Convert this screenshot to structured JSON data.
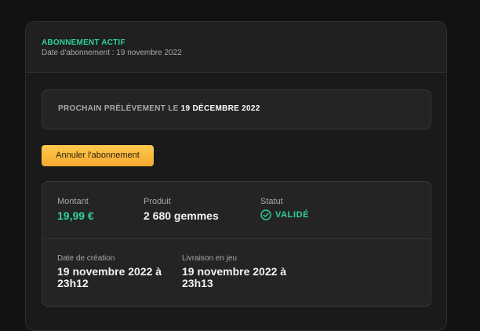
{
  "header": {
    "status_title": "ABONNEMENT ACTIF",
    "subscription_date": "Date d'abonnement : 19 novembre 2022"
  },
  "next_charge": {
    "prefix": "PROCHAIN PRÉLÈVEMENT LE ",
    "date": "19 DÉCEMBRE 2022"
  },
  "actions": {
    "cancel_label": "Annuler l'abonnement"
  },
  "details": {
    "amount_label": "Montant",
    "amount_value": "19,99 €",
    "product_label": "Produit",
    "product_value": "2 680 gemmes",
    "status_label": "Statut",
    "status_value": "VALIDÉ",
    "status_icon": "check-circle-icon",
    "created_label": "Date de création",
    "created_value": "19 novembre 2022 à 23h12",
    "delivery_label": "Livraison en jeu",
    "delivery_value": "19 novembre 2022 à 23h13"
  },
  "colors": {
    "accent_green": "#2fd39a",
    "button_yellow": "#ffc94e",
    "background": "#121212",
    "card": "#1a1a1a"
  }
}
